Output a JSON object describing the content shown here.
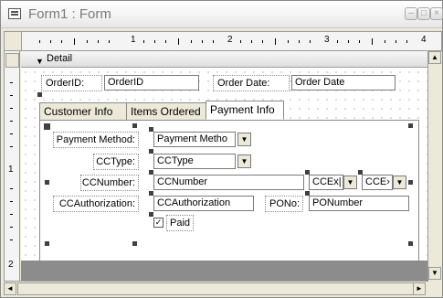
{
  "window": {
    "title": "Form1 : Form",
    "minimize_label": "–",
    "restore_label": "□",
    "close_label": "×"
  },
  "ruler": {
    "top_numbers": [
      "1",
      "2",
      "3",
      "4"
    ],
    "left_numbers": [
      "1",
      "2"
    ]
  },
  "detail": {
    "label": "Detail",
    "arrow": "▼"
  },
  "header_fields": {
    "order_id_label": "OrderID:",
    "order_id_value": "OrderID",
    "order_date_label": "Order Date:",
    "order_date_value": "Order Date"
  },
  "tabs": [
    {
      "label": "Customer Info"
    },
    {
      "label": "Items Ordered"
    },
    {
      "label": "Payment Info",
      "active": true
    }
  ],
  "payment": {
    "method_label": "Payment Method:",
    "method_value": "Payment Metho",
    "cctype_label": "CCType:",
    "cctype_value": "CCType",
    "ccnumber_label": "CCNumber:",
    "ccnumber_value": "CCNumber",
    "ccexp1_value": "CCEx|",
    "ccexp2_value": "CCE›",
    "ccauth_label": "CCAuthorization:",
    "ccauth_value": "CCAuthorization",
    "pono_label": "PONo:",
    "pono_value": "PONumber",
    "paid_label": "Paid",
    "paid_checked": true,
    "check_mark": "✓"
  },
  "dropdown_glyph": "▼",
  "scroll": {
    "left": "◄",
    "right": "►",
    "up": "▲",
    "down": "▼"
  }
}
